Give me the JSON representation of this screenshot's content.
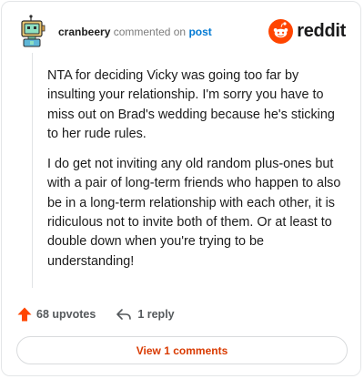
{
  "comment": {
    "author": "cranbeery",
    "verb": "commented on",
    "post_link": "post",
    "paragraphs": [
      "NTA for deciding Vicky was going too far by insulting your relationship. I'm sorry you have to miss out on Brad's wedding because he's sticking to her rude rules.",
      "I do get not inviting any old random plus-ones but with a pair of long-term friends who happen to also be in a long-term relationship with each other, it is ridiculous not to invite both of them. Or at least to double down when you're trying to be understanding!"
    ]
  },
  "brand": {
    "wordmark": "reddit",
    "icon": "reddit-alien-icon",
    "color": "#ff4500"
  },
  "actions": {
    "upvotes_label": "68 upvotes",
    "upvote_icon": "upvote-arrow-icon",
    "upvote_color": "#ff4500",
    "reply_label": "1 reply",
    "reply_icon": "reply-arrow-icon"
  },
  "view_comments": {
    "label": "View 1 comments",
    "color": "#d93a00"
  },
  "avatar": {
    "icon": "robot-avatar-icon"
  }
}
